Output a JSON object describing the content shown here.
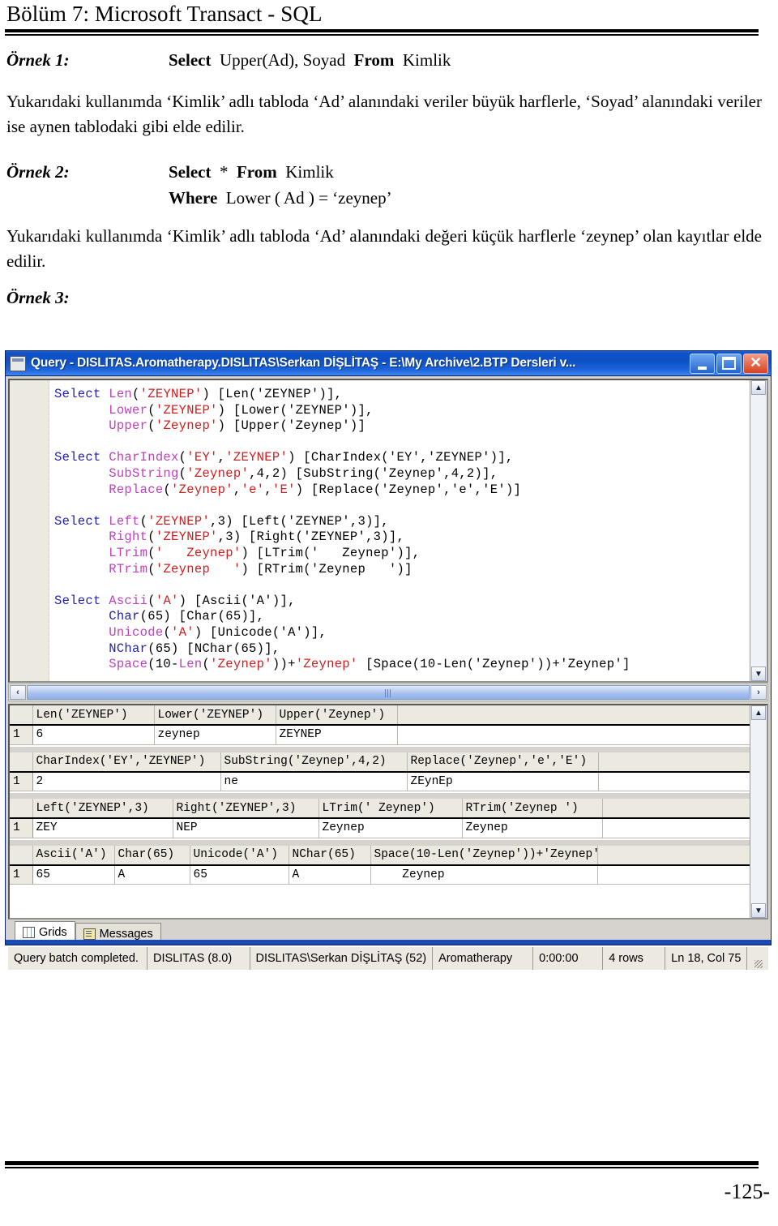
{
  "document": {
    "title": "Bölüm 7: Microsoft Transact - SQL",
    "page_number": "-125-"
  },
  "examples": [
    {
      "label": "Örnek 1:",
      "code_line1_kw1": "Select",
      "code_line1_mid": "Upper(Ad), Soyad",
      "code_line1_kw2": "From",
      "code_line1_end": "Kimlik",
      "paragraph": "Yukarıdaki kullanımda ‘Kimlik’ adlı tabloda ‘Ad’ alanındaki veriler büyük harflerle, ‘Soyad’ alanındaki veriler ise aynen tablodaki gibi elde edilir."
    },
    {
      "label": "Örnek 2:",
      "code_line1_kw1": "Select",
      "code_line1_mid": "*",
      "code_line1_kw2": "From",
      "code_line1_end": "Kimlik",
      "code_line2_kw": "Where",
      "code_line2_rest": "Lower ( Ad ) = ‘zeynep’",
      "paragraph": "Yukarıdaki kullanımda ‘Kimlik’ adlı tabloda ‘Ad’ alanındaki değeri küçük harflerle ‘zeynep’ olan kayıtlar elde edilir."
    },
    {
      "label": "Örnek 3:"
    }
  ],
  "window": {
    "title": "Query - DISLITAS.Aromatherapy.DISLITAS\\Serkan DİŞLİTAŞ - E:\\My Archive\\2.BTP Dersleri v...",
    "buttons": {
      "minimize": "minimize",
      "maximize": "maximize",
      "close": "✕"
    },
    "editor": {
      "lines": [
        [
          {
            "t": "Select ",
            "c": "kw"
          },
          {
            "t": "Len",
            "c": "fn"
          },
          {
            "t": "(",
            "c": "txt"
          },
          {
            "t": "'ZEYNEP'",
            "c": "str"
          },
          {
            "t": ") [Len('ZEYNEP')],",
            "c": "txt"
          }
        ],
        [
          {
            "t": "       ",
            "c": "txt"
          },
          {
            "t": "Lower",
            "c": "fn"
          },
          {
            "t": "(",
            "c": "txt"
          },
          {
            "t": "'ZEYNEP'",
            "c": "str"
          },
          {
            "t": ") [Lower('ZEYNEP')],",
            "c": "txt"
          }
        ],
        [
          {
            "t": "       ",
            "c": "txt"
          },
          {
            "t": "Upper",
            "c": "fn"
          },
          {
            "t": "(",
            "c": "txt"
          },
          {
            "t": "'Zeynep'",
            "c": "str"
          },
          {
            "t": ") [Upper('Zeynep')]",
            "c": "txt"
          }
        ],
        [],
        [
          {
            "t": "Select ",
            "c": "kw"
          },
          {
            "t": "CharIndex",
            "c": "fn"
          },
          {
            "t": "(",
            "c": "txt"
          },
          {
            "t": "'EY'",
            "c": "str"
          },
          {
            "t": ",",
            "c": "txt"
          },
          {
            "t": "'ZEYNEP'",
            "c": "str"
          },
          {
            "t": ") [CharIndex('EY','ZEYNEP')],",
            "c": "txt"
          }
        ],
        [
          {
            "t": "       ",
            "c": "txt"
          },
          {
            "t": "SubString",
            "c": "fn"
          },
          {
            "t": "(",
            "c": "txt"
          },
          {
            "t": "'Zeynep'",
            "c": "str"
          },
          {
            "t": ",4,2) [SubString('Zeynep',4,2)],",
            "c": "txt"
          }
        ],
        [
          {
            "t": "       ",
            "c": "txt"
          },
          {
            "t": "Replace",
            "c": "fn"
          },
          {
            "t": "(",
            "c": "txt"
          },
          {
            "t": "'Zeynep'",
            "c": "str"
          },
          {
            "t": ",",
            "c": "txt"
          },
          {
            "t": "'e'",
            "c": "str"
          },
          {
            "t": ",",
            "c": "txt"
          },
          {
            "t": "'E'",
            "c": "str"
          },
          {
            "t": ") [Replace('Zeynep','e','E')]",
            "c": "txt"
          }
        ],
        [],
        [
          {
            "t": "Select ",
            "c": "kw"
          },
          {
            "t": "Left",
            "c": "fn"
          },
          {
            "t": "(",
            "c": "txt"
          },
          {
            "t": "'ZEYNEP'",
            "c": "str"
          },
          {
            "t": ",3) [Left('ZEYNEP',3)],",
            "c": "txt"
          }
        ],
        [
          {
            "t": "       ",
            "c": "txt"
          },
          {
            "t": "Right",
            "c": "fn"
          },
          {
            "t": "(",
            "c": "txt"
          },
          {
            "t": "'ZEYNEP'",
            "c": "str"
          },
          {
            "t": ",3) [Right('ZEYNEP',3)],",
            "c": "txt"
          }
        ],
        [
          {
            "t": "       ",
            "c": "txt"
          },
          {
            "t": "LTrim",
            "c": "fn"
          },
          {
            "t": "(",
            "c": "txt"
          },
          {
            "t": "'   Zeynep'",
            "c": "str"
          },
          {
            "t": ") [LTrim('   Zeynep')],",
            "c": "txt"
          }
        ],
        [
          {
            "t": "       ",
            "c": "txt"
          },
          {
            "t": "RTrim",
            "c": "fn"
          },
          {
            "t": "(",
            "c": "txt"
          },
          {
            "t": "'Zeynep   '",
            "c": "str"
          },
          {
            "t": ") [RTrim('Zeynep   ')]",
            "c": "txt"
          }
        ],
        [],
        [
          {
            "t": "Select ",
            "c": "kw"
          },
          {
            "t": "Ascii",
            "c": "fn"
          },
          {
            "t": "(",
            "c": "txt"
          },
          {
            "t": "'A'",
            "c": "str"
          },
          {
            "t": ") [Ascii('A')],",
            "c": "txt"
          }
        ],
        [
          {
            "t": "       ",
            "c": "txt"
          },
          {
            "t": "Char",
            "c": "kw"
          },
          {
            "t": "(65) [Char(65)],",
            "c": "txt"
          }
        ],
        [
          {
            "t": "       ",
            "c": "txt"
          },
          {
            "t": "Unicode",
            "c": "fn"
          },
          {
            "t": "(",
            "c": "txt"
          },
          {
            "t": "'A'",
            "c": "str"
          },
          {
            "t": ") [Unicode('A')],",
            "c": "txt"
          }
        ],
        [
          {
            "t": "       ",
            "c": "txt"
          },
          {
            "t": "NChar",
            "c": "kw"
          },
          {
            "t": "(65) [NChar(65)],",
            "c": "txt"
          }
        ],
        [
          {
            "t": "       ",
            "c": "txt"
          },
          {
            "t": "Space",
            "c": "fn"
          },
          {
            "t": "(10-",
            "c": "txt"
          },
          {
            "t": "Len",
            "c": "fn"
          },
          {
            "t": "(",
            "c": "txt"
          },
          {
            "t": "'Zeynep'",
            "c": "str"
          },
          {
            "t": "))+",
            "c": "txt"
          },
          {
            "t": "'Zeynep'",
            "c": "str"
          },
          {
            "t": " [Space(10-Len('Zeynep'))+'Zeynep']",
            "c": "txt"
          }
        ]
      ]
    },
    "results": {
      "grids": [
        {
          "columns": [
            "Len('ZEYNEP')",
            "Lower('ZEYNEP')",
            "Upper('Zeynep')"
          ],
          "widths": [
            150,
            150,
            150
          ],
          "rows": [
            {
              "num": "1",
              "cells": [
                "6",
                "zeynep",
                "ZEYNEP"
              ]
            }
          ]
        },
        {
          "columns": [
            "CharIndex('EY','ZEYNEP')",
            "SubString('Zeynep',4,2)",
            "Replace('Zeynep','e','E')"
          ],
          "widths": [
            232,
            230,
            236
          ],
          "rows": [
            {
              "num": "1",
              "cells": [
                "2",
                "ne",
                "ZEynEp"
              ]
            }
          ]
        },
        {
          "columns": [
            "Left('ZEYNEP',3)",
            "Right('ZEYNEP',3)",
            "LTrim('   Zeynep')",
            "RTrim('Zeynep   ')"
          ],
          "widths": [
            173,
            180,
            177,
            173
          ],
          "rows": [
            {
              "num": "1",
              "cells": [
                "ZEY",
                "NEP",
                "Zeynep",
                "Zeynep"
              ]
            }
          ]
        },
        {
          "columns": [
            "Ascii('A')",
            "Char(65)",
            "Unicode('A')",
            "NChar(65)",
            "Space(10-Len('Zeynep'))+'Zeynep'"
          ],
          "widths": [
            101,
            93,
            122,
            101,
            280
          ],
          "rows": [
            {
              "num": "1",
              "cells": [
                "65",
                "A",
                "65",
                "A",
                "    Zeynep"
              ]
            }
          ]
        }
      ]
    },
    "tabs": [
      {
        "label": "Grids",
        "icon": "grid-icon",
        "active": true
      },
      {
        "label": "Messages",
        "icon": "message-icon",
        "active": false
      }
    ],
    "statusbar": [
      "Query batch completed.",
      "DISLITAS (8.0)",
      "DISLITAS\\Serkan DİŞLİTAŞ (52)",
      "Aromatherapy",
      "0:00:00",
      "4 rows",
      "Ln 18, Col 75"
    ]
  },
  "colors": {
    "keyword": "#1f1fb4",
    "function": "#c040c0",
    "string": "#d21d1d",
    "titlebar": "#0d4fc4",
    "close_button": "#d6421e"
  }
}
